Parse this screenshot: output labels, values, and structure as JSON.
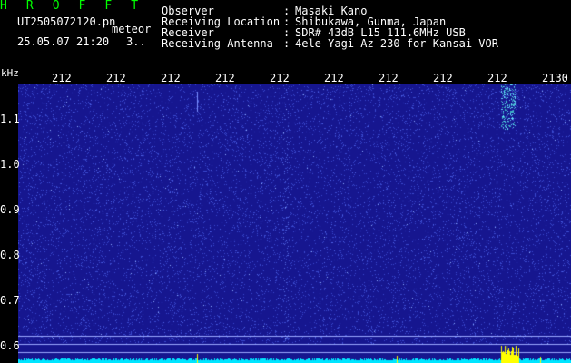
{
  "header": {
    "app_name": "H R O F F T",
    "file_name": "UT2505072120.pn",
    "mode": "meteor",
    "date_time": "25.05.07 21:20",
    "index": "3.."
  },
  "station_info": [
    {
      "label": "Observer",
      "value": "Masaki Kano"
    },
    {
      "label": "Receiving Location",
      "value": "Shibukawa, Gunma, Japan"
    },
    {
      "label": "Receiver",
      "value": "SDR# 43dB L15 111.6MHz USB"
    },
    {
      "label": "Receiving Antenna",
      "value": "4ele Yagi Az 230 for Kansai VOR"
    }
  ],
  "spectrogram": {
    "unit_label": "kHz",
    "x_ticks": [
      "212",
      "212",
      "212",
      "212",
      "212",
      "212",
      "212",
      "212",
      "212",
      "2130"
    ],
    "y_ticks": [
      "1.1",
      "1.0",
      "0.9",
      "0.8",
      "0.7",
      "0.6"
    ],
    "colors": {
      "background": "#16168f",
      "noise": "#3a4bd0",
      "signal": "#66ddff",
      "baseline": "#00e5ff",
      "peak": "#ffff00",
      "text": "#ffffff",
      "title": "#00ff00"
    }
  }
}
